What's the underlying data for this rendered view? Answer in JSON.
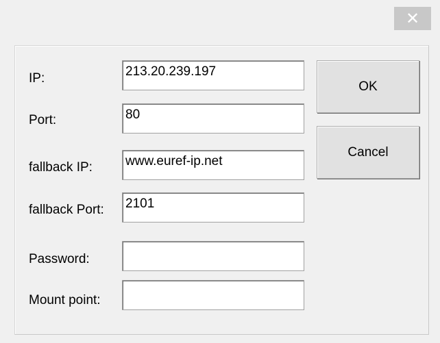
{
  "window": {
    "close_glyph": "✕"
  },
  "form": {
    "ip": {
      "label": "IP:",
      "value": "213.20.239.197"
    },
    "port": {
      "label": "Port:",
      "value": "80"
    },
    "fallback_ip": {
      "label": "fallback IP:",
      "value": "www.euref-ip.net"
    },
    "fallback_port": {
      "label": "fallback Port:",
      "value": "2101"
    },
    "password": {
      "label": "Password:",
      "value": ""
    },
    "mount_point": {
      "label": "Mount point:",
      "value": ""
    }
  },
  "buttons": {
    "ok_label": "OK",
    "cancel_label": "Cancel"
  },
  "colors": {
    "dialog_bg": "#f0f0f0",
    "close_button_bg": "#c8c8c8",
    "button_bg": "#e1e1e1",
    "field_bg": "#ffffff"
  }
}
